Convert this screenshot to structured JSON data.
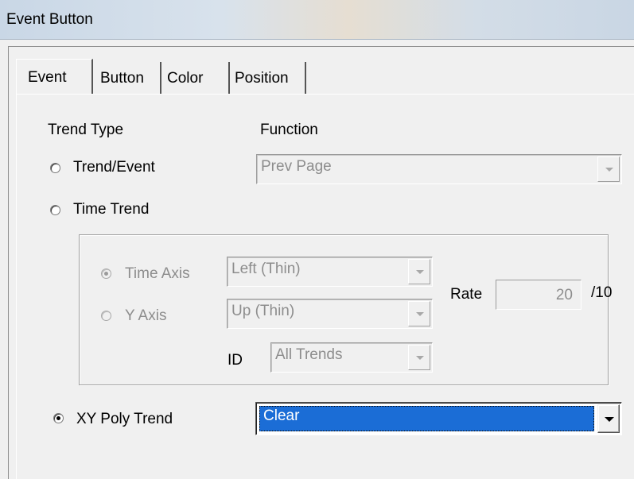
{
  "window": {
    "title": "Event Button"
  },
  "tabs": [
    {
      "label": "Event",
      "active": true
    },
    {
      "label": "Button",
      "active": false
    },
    {
      "label": "Color",
      "active": false
    },
    {
      "label": "Position",
      "active": false
    }
  ],
  "event": {
    "trend_type_label": "Trend Type",
    "function_label": "Function",
    "trend_event": {
      "label": "Trend/Event",
      "checked": false
    },
    "function_combo": {
      "value": "Prev Page",
      "enabled": false
    },
    "time_trend": {
      "label": "Time Trend",
      "checked": false
    },
    "time_group": {
      "time_axis": {
        "label": "Time Axis",
        "checked": true,
        "enabled": false
      },
      "time_axis_combo": {
        "value": "Left (Thin)",
        "enabled": false
      },
      "y_axis": {
        "label": "Y Axis",
        "checked": false,
        "enabled": false
      },
      "y_axis_combo": {
        "value": "Up (Thin)",
        "enabled": false
      },
      "id_label": "ID",
      "id_combo": {
        "value": "All Trends",
        "enabled": false
      },
      "rate_label": "Rate",
      "rate_value": "20",
      "rate_suffix": "/10"
    },
    "xy_poly_trend": {
      "label": "XY Poly Trend",
      "checked": true
    },
    "xy_combo": {
      "value": "Clear",
      "enabled": true
    }
  },
  "colors": {
    "selection": "#1b6dd6",
    "disabled_text": "#8d8d8d",
    "dialog_bg": "#f0f0f0"
  }
}
